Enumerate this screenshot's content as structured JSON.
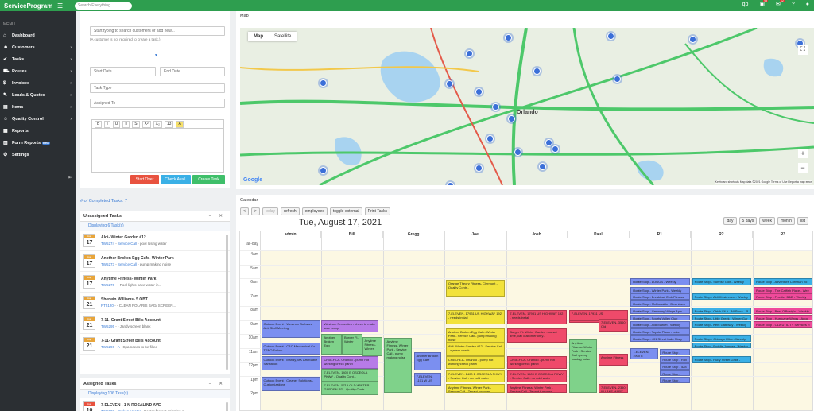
{
  "topbar": {
    "brand": "ServiceProgram",
    "search_placeholder": "Search Everything...",
    "badges": {
      "orders": "99",
      "alerts": "12"
    }
  },
  "sidebar": {
    "menu_header": "MENU",
    "items": [
      {
        "label": "Dashboard",
        "icon": "home-icon"
      },
      {
        "label": "Customers",
        "icon": "user-icon"
      },
      {
        "label": "Tasks",
        "icon": "tasks-icon"
      },
      {
        "label": "Routes",
        "icon": "truck-icon"
      },
      {
        "label": "Invoices",
        "icon": "invoice-icon"
      },
      {
        "label": "Leads & Quotes",
        "icon": "leads-icon"
      },
      {
        "label": "Items",
        "icon": "box-icon"
      },
      {
        "label": "Quality Control",
        "icon": "people-icon"
      },
      {
        "label": "Reports",
        "icon": "report-icon"
      },
      {
        "label": "Form Reports",
        "icon": "form-icon",
        "badge": "Beta"
      },
      {
        "label": "Settings",
        "icon": "gear-icon"
      }
    ]
  },
  "task_form": {
    "customer_placeholder": "Start typing to search customers or add new...",
    "customer_note": "(A customer is not required to create a task.)",
    "start_date": "Start Date",
    "end_date": "End Date",
    "task_type": "Task Type",
    "assigned_to": "Assigned To",
    "font_size": "13",
    "buttons": {
      "start_over": "Start Over",
      "check_avail": "Check Avail.",
      "create_task": "Create Task"
    }
  },
  "completed_tasks": "# of Completed Tasks: 7",
  "unassigned": {
    "title": "Unassigned Tasks",
    "displaying": "Displaying 6 Task(s)",
    "tasks": [
      {
        "month": "Aug",
        "day": "17",
        "title": "Aldi- Winter Garden #12",
        "id": "TW5274",
        "type": "Service Call",
        "desc": "pool losing water"
      },
      {
        "month": "Aug",
        "day": "17",
        "title": "Another Broken Egg Cafe- Winter Park",
        "id": "TW5273",
        "type": "Service Call",
        "desc": "pump making noise"
      },
      {
        "month": "Aug",
        "day": "17",
        "title": "Anytime Fitness- Winter Park",
        "id": "TW5276",
        "type": "",
        "desc": "Pool lights have water in..."
      },
      {
        "month": "Aug",
        "day": "21",
        "title": "Sherwin Williams- 5 OBT",
        "id": "RT5120",
        "type": "",
        "desc": "CLEAN POLARIS BAG/ SCREEN..."
      },
      {
        "month": "Aug",
        "day": "21",
        "title": "7-11- Grant Street Bills Account",
        "id": "TW5295",
        "type": "",
        "desc": "Jandy screen blank"
      },
      {
        "month": "Aug",
        "day": "21",
        "title": "7-11- Grant Street Bills Account",
        "id": "TW5296",
        "type": "A",
        "desc": "Spa needs to be filled"
      }
    ]
  },
  "assigned": {
    "title": "Assigned Tasks",
    "displaying": "Displaying 106 Task(s)",
    "tasks": [
      {
        "month": "Aug",
        "day": "10",
        "title": "7-ELEVEN - 1 N ROSALIND AVE",
        "id": "TW5002",
        "type": "Broken Heater",
        "desc": "Heater fan not spinning a..."
      }
    ]
  },
  "map": {
    "label": "Map",
    "tabs": [
      "Map",
      "Satellite"
    ],
    "city": "Orlando",
    "attribution": "Keyboard shortcuts  Map data ©2021 Google  Terms of Use  Report a map error"
  },
  "calendar": {
    "label": "Calendar",
    "nav": [
      "today",
      "refresh",
      "employees",
      "toggle external",
      "Print Tasks"
    ],
    "title": "Tue, August 17, 2021",
    "views": [
      "day",
      "5 days",
      "week",
      "month",
      "list"
    ],
    "all_day": "all-day",
    "columns": [
      "admin",
      "Bill",
      "Gregg",
      "Joe",
      "Josh",
      "Paul",
      "R1",
      "R2",
      "R3"
    ],
    "times": [
      "4am",
      "5am",
      "6am",
      "7am",
      "8am",
      "9am",
      "10am",
      "11am",
      "12pm",
      "1pm",
      "2pm"
    ],
    "events": [
      {
        "text": "Outlook Event - Westrom Software ALL Staff Meeting",
        "color": "#7b8ff0"
      },
      {
        "text": "Westrom Properties - check to make sure pump",
        "color": "#b77be8"
      },
      {
        "text": "Another Broken Egg",
        "color": "#7fd28a"
      },
      {
        "text": "Burger Fi- Winter",
        "color": "#7fd28a"
      },
      {
        "text": "Anytime Fitness- Winter",
        "color": "#7fd28a"
      },
      {
        "text": "Outlook Event - C&C Mechanical Co - TSPO Follow",
        "color": "#7b8ff0"
      },
      {
        "text": "Outlook Event - Mandy, MK Affordable Sanitation",
        "color": "#7b8ff0"
      },
      {
        "text": "Chick-Fil-A- Orlando - pump not working/check panel",
        "color": "#b77be8"
      },
      {
        "text": "7-ELEVEN- 1400 E OSCEOLA PKWY - Quality Cont...",
        "color": "#7fd28a"
      },
      {
        "text": "Outlook Event - Cleaner Solutions - Customizations",
        "color": "#7b8ff0"
      },
      {
        "text": "7-ELEVEN- 5719 OLD WINTER GARDEN RD - Quality Contr -",
        "color": "#7fd28a"
      },
      {
        "text": "Anytime Fitness- Winter Park - Service Call - pump making noise",
        "color": "#7fd28a"
      },
      {
        "text": "Another Broken Egg Cafe",
        "color": "#7b8ff0"
      },
      {
        "text": "7-ELEVEN- 1101 W US",
        "color": "#7b8ff0"
      },
      {
        "text": "Orange Theory Fitness- Clermont - Quality Contr -",
        "color": "#f2e23a"
      },
      {
        "text": "7-ELEVEN- 17931 US HIGHWAY 192 - needs install",
        "color": "#f2e23a"
      },
      {
        "text": "Another Broken Egg Cafe- Winter Park - Service Call - pump making noise",
        "color": "#f2e23a"
      },
      {
        "text": "Aldi- Winter Garden #12 - Service Call - system check",
        "color": "#f2e23a"
      },
      {
        "text": "Chick-Fil-A- Orlando - pump not working/check panel",
        "color": "#f2e23a"
      },
      {
        "text": "7-ELEVEN- 1400 E OSCEOLA PKWY - Service Call - no cold water",
        "color": "#f2e23a"
      },
      {
        "text": "Anytime Fitness- Winter Park - Service Call - Tenant turnover",
        "color": "#f2e23a"
      },
      {
        "text": "7-ELEVEN- 17931 US HIGHWAY 192 - needs install",
        "color": "#ef4a6a"
      },
      {
        "text": "Burger Fi- Winter Garden - no set time, call customer on y...",
        "color": "#ef4a6a"
      },
      {
        "text": "IHOP- ELECTIC - NO CART ON DECK",
        "color": "#ef4a6a"
      },
      {
        "text": "Chick-Fil-A- Orlando - pump not working/check panel",
        "color": "#ef4a6a"
      },
      {
        "text": "7-ELEVEN- 1400 E OSCEOLA PKWY - Service Call - no cold water",
        "color": "#ef4a6a"
      },
      {
        "text": "Anytime Fitness- Winter Park - Service Call - Tenant turnover",
        "color": "#ef4a6a"
      },
      {
        "text": "7-ELEVEN- 17931 US",
        "color": "#ef4a6a"
      },
      {
        "text": "7-ELEVEN- 3560 Old",
        "color": "#ef4a6a"
      },
      {
        "text": "Anytime Fitness- Winter Park - Service Call - pump making noise",
        "color": "#7fd28a"
      },
      {
        "text": "Anytime Fitness",
        "color": "#ef4a6a"
      },
      {
        "text": "7-ELEVEN- 2350 W LAKE MARY BLVD",
        "color": "#ef4a6a"
      },
      {
        "text": "Route Stop - LOGOS - Weekly",
        "color": "#7b8ff0"
      },
      {
        "text": "Route Stop - Winter Park - Weekly",
        "color": "#7b8ff0"
      },
      {
        "text": "Route Stop - Breakfast Club Fitness",
        "color": "#7b8ff0"
      },
      {
        "text": "Route Stop - McDonalds - Downtown",
        "color": "#7b8ff0"
      },
      {
        "text": "Route Stop - Germany Village Apts",
        "color": "#7b8ff0"
      },
      {
        "text": "Route Stop - Sports Valley Club",
        "color": "#7b8ff0"
      },
      {
        "text": "Route Stop - Aldi Market - Weekly",
        "color": "#7b8ff0"
      },
      {
        "text": "Route Stop - Toyota Plaza - Lake Mary",
        "color": "#7b8ff0"
      },
      {
        "text": "Route Stop - 401 Street Lake Mary",
        "color": "#7b8ff0"
      },
      {
        "text": "7-ELEVEN- 1900 E",
        "color": "#7b8ff0"
      },
      {
        "text": "Route Stop - Orlando Power Fitness",
        "color": "#7b8ff0"
      },
      {
        "text": "Route Stop - Rox Family",
        "color": "#7b8ff0"
      },
      {
        "text": "Route Stop - 528 The Strand",
        "color": "#7b8ff0"
      },
      {
        "text": "Route Stop - New Times Pilates Grd",
        "color": "#7b8ff0"
      },
      {
        "text": "Route Stop - Sunrise Golf",
        "color": "#7b8ff0"
      },
      {
        "text": "Route Stop - Sunrise Golf - Weekly",
        "color": "#3ab0e6"
      },
      {
        "text": "Route Stop - Aldi Kissimmee - Weekly",
        "color": "#3ab0e6"
      },
      {
        "text": "Route Stop - Chick Fil A - All Stock - R",
        "color": "#3ab0e6"
      },
      {
        "text": "Route Stop - Little Greek - Winter Gar",
        "color": "#3ab0e6"
      },
      {
        "text": "Route Stop - Kent Gateway - Weekly",
        "color": "#3ab0e6"
      },
      {
        "text": "Route Stop - Chicago Ultra - Weekly",
        "color": "#3ab0e6"
      },
      {
        "text": "Route Stop - Puddle Jumper - Weekly",
        "color": "#3ab0e6"
      },
      {
        "text": "Route Stop - Ruby Street Grille - Weekly",
        "color": "#3ab0e6"
      },
      {
        "text": "Route Stop - Adventure Christian Vo",
        "color": "#3ab0e6"
      },
      {
        "text": "Route Stop - The Catfish Place - Wee",
        "color": "#ef4a9b"
      },
      {
        "text": "Route Stop - Frontier B&D - Weekly",
        "color": "#ef4a9b"
      },
      {
        "text": "Route Stop - Beef O'Brady's - Weekly",
        "color": "#ef4a9b"
      },
      {
        "text": "Route Stop - Hurricane Wings - Apop",
        "color": "#ef4a9b"
      },
      {
        "text": "Route Stop - OLA UTILITY Services R",
        "color": "#ef4a9b"
      },
      {
        "text": "Route Stop - Aldi- Altamonte Spring",
        "color": "#ef4a9b"
      }
    ]
  },
  "colors": {
    "brand": "#2e9e4f",
    "sidebar": "#2b2f33",
    "link": "#3a7bd5",
    "start_over": "#e8523f",
    "check_avail": "#3ab0e6",
    "create_task": "#3fbf6a"
  }
}
